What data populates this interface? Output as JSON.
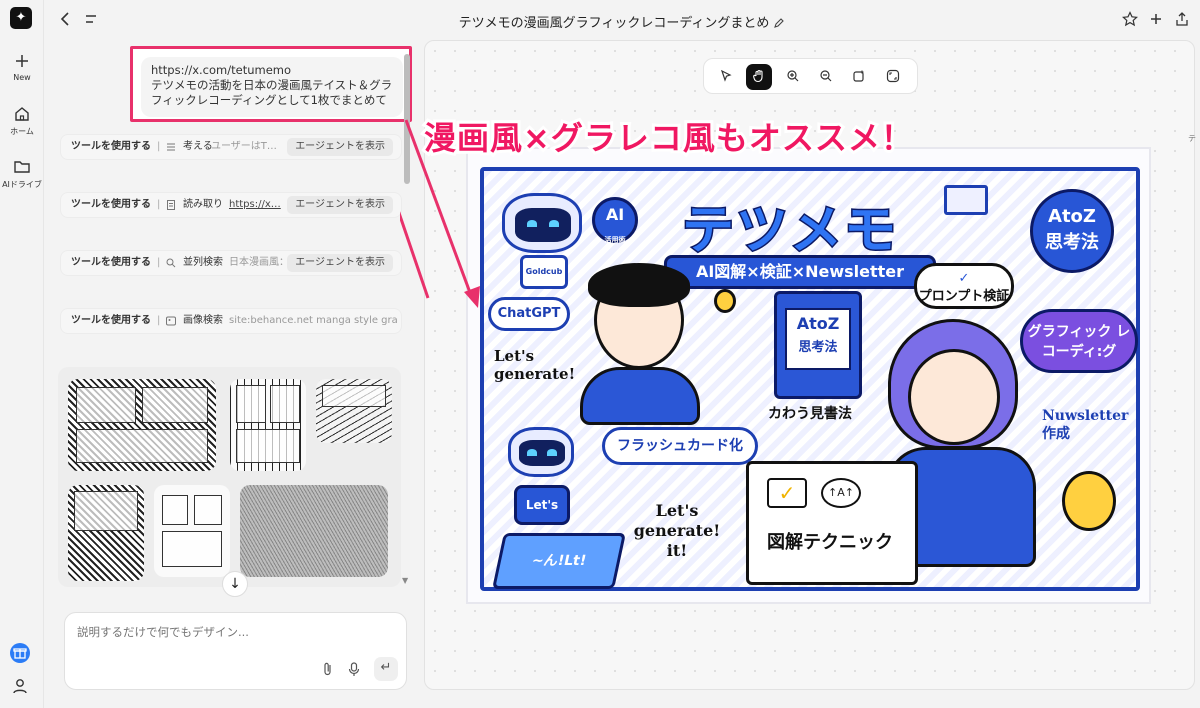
{
  "rail": {
    "new_label": "New",
    "home_label": "ホーム",
    "drive_label": "AIドライブ"
  },
  "header": {
    "title": "テツメモの漫画風グラフィックレコーディングまとめ"
  },
  "chat": {
    "request_url": "https://x.com/tetumemo",
    "request_text": "テツメモの活動を日本の漫画風テイスト＆グラフィックレコーディングとして1枚でまとめて",
    "tools": [
      {
        "name": "ツールを使用する",
        "action": "考える",
        "detail": "ユーザーはT…",
        "agent": "エージェントを表示"
      },
      {
        "name": "ツールを使用する",
        "action": "読み取り",
        "detail": "https://x…",
        "agent": "エージェントを表示"
      },
      {
        "name": "ツールを使用する",
        "action": "並列検索",
        "detail": "日本漫画風：",
        "agent": "エージェントを表示"
      },
      {
        "name": "ツールを使用する",
        "action": "画像検索",
        "detail": "site:behance.net manga style gra…",
        "agent": ""
      }
    ],
    "input_placeholder": "説明するだけで何でもデザイン..."
  },
  "annotation": {
    "headline": "漫画風×グラレコ風もオススメ！",
    "color": "#f01862"
  },
  "canvas_tools": [
    "pointer-tool",
    "hand-tool",
    "zoom-in-tool",
    "zoom-out-tool",
    "frame-tool",
    "fit-tool"
  ],
  "canvas_side_label": "テ",
  "artwork": {
    "logo": "テツメモ",
    "banner": "AI図解×検証×Newsletter",
    "ai_badge": "AI",
    "ai_badge_sub": "活用術",
    "atoz_badge_top": "AtoZ",
    "atoz_badge_bottom": "思考法",
    "chatgpt": "ChatGPT",
    "lets_generate": "Let's generate!",
    "book_title_top": "AtoZ",
    "book_title_bottom": "思考法",
    "book_caption": "カわう見書法",
    "prompt_check": "プロンプト検証",
    "graphic_rec": "グラフィック レコーディ:グ",
    "flashcard": "フラッシュカード化",
    "lets_generate_it": "Let's generate! it!",
    "newsletter": "Nuwsletter 作成",
    "robot_screen": "Let's",
    "tablet_text": "~ん!Lt!",
    "notebook_title": "図解テクニック",
    "robot_label": "Goldcub",
    "brand_blue": "#2856d6",
    "navy": "#0c1a66"
  }
}
